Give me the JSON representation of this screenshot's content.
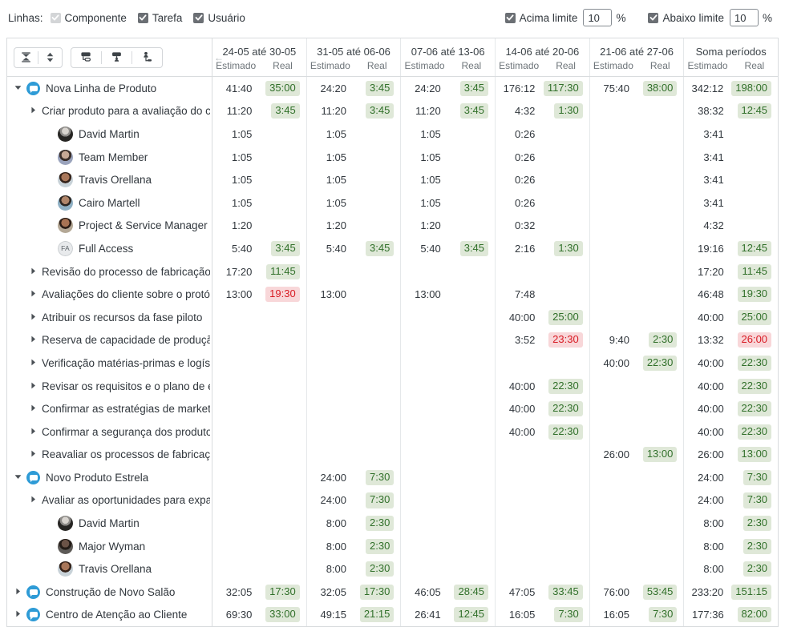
{
  "filters": {
    "rows_label": "Linhas:",
    "checkboxes": [
      {
        "label": "Componente",
        "checked": true,
        "disabled": true
      },
      {
        "label": "Tarefa",
        "checked": true,
        "disabled": false
      },
      {
        "label": "Usuário",
        "checked": true,
        "disabled": false
      }
    ],
    "above_limit": {
      "label": "Acima limite",
      "value": "10",
      "unit": "%",
      "checked": true
    },
    "below_limit": {
      "label": "Abaixo limite",
      "value": "10",
      "unit": "%",
      "checked": true
    }
  },
  "toolbar": {
    "collapse_all": "collapse-all-icon",
    "expand_all": "expand-all-icon",
    "group_component": "group-by-component-icon",
    "group_task": "group-by-task-icon",
    "group_user": "group-by-user-icon",
    "scroll_back": "←"
  },
  "columns": {
    "sub_estimated": "Estimado",
    "sub_real": "Real",
    "periods": [
      "24-05 até 30-05",
      "31-05 até 06-06",
      "07-06 até 13-06",
      "14-06 até 20-06",
      "21-06 até 27-06",
      "Soma períodos"
    ]
  },
  "rows": [
    {
      "name": "Nova Linha de Produto",
      "level": 0,
      "type": "project",
      "expanded": true,
      "cells": [
        {
          "est": "41:40",
          "real": "35:00",
          "state": "ok"
        },
        {
          "est": "24:20",
          "real": "3:45",
          "state": "ok"
        },
        {
          "est": "24:20",
          "real": "3:45",
          "state": "ok"
        },
        {
          "est": "176:12",
          "real": "117:30",
          "state": "ok"
        },
        {
          "est": "75:40",
          "real": "38:00",
          "state": "ok"
        },
        {
          "est": "342:12",
          "real": "198:00",
          "state": "ok"
        }
      ]
    },
    {
      "name": "Criar produto para a avaliação do cliente",
      "level": 1,
      "type": "task",
      "expanded": false,
      "cells": [
        {
          "est": "11:20",
          "real": "3:45",
          "state": "ok"
        },
        {
          "est": "11:20",
          "real": "3:45",
          "state": "ok"
        },
        {
          "est": "11:20",
          "real": "3:45",
          "state": "ok"
        },
        {
          "est": "4:32",
          "real": "1:30",
          "state": "ok"
        },
        {
          "est": "",
          "real": "",
          "state": "none"
        },
        {
          "est": "38:32",
          "real": "12:45",
          "state": "ok"
        }
      ]
    },
    {
      "name": "David Martin",
      "level": 2,
      "type": "user",
      "avatar": "photo-male-1",
      "cells": [
        {
          "est": "1:05",
          "real": "",
          "state": "none"
        },
        {
          "est": "1:05",
          "real": "",
          "state": "none"
        },
        {
          "est": "1:05",
          "real": "",
          "state": "none"
        },
        {
          "est": "0:26",
          "real": "",
          "state": "none"
        },
        {
          "est": "",
          "real": "",
          "state": "none"
        },
        {
          "est": "3:41",
          "real": "",
          "state": "none"
        }
      ]
    },
    {
      "name": "Team Member",
      "level": 2,
      "type": "user",
      "avatar": "photo-male-2",
      "cells": [
        {
          "est": "1:05",
          "real": "",
          "state": "none"
        },
        {
          "est": "1:05",
          "real": "",
          "state": "none"
        },
        {
          "est": "1:05",
          "real": "",
          "state": "none"
        },
        {
          "est": "0:26",
          "real": "",
          "state": "none"
        },
        {
          "est": "",
          "real": "",
          "state": "none"
        },
        {
          "est": "3:41",
          "real": "",
          "state": "none"
        }
      ]
    },
    {
      "name": "Travis Orellana",
      "level": 2,
      "type": "user",
      "avatar": "photo-male-3",
      "cells": [
        {
          "est": "1:05",
          "real": "",
          "state": "none"
        },
        {
          "est": "1:05",
          "real": "",
          "state": "none"
        },
        {
          "est": "1:05",
          "real": "",
          "state": "none"
        },
        {
          "est": "0:26",
          "real": "",
          "state": "none"
        },
        {
          "est": "",
          "real": "",
          "state": "none"
        },
        {
          "est": "3:41",
          "real": "",
          "state": "none"
        }
      ]
    },
    {
      "name": "Cairo Martell",
      "level": 2,
      "type": "user",
      "avatar": "photo-male-4",
      "cells": [
        {
          "est": "1:05",
          "real": "",
          "state": "none"
        },
        {
          "est": "1:05",
          "real": "",
          "state": "none"
        },
        {
          "est": "1:05",
          "real": "",
          "state": "none"
        },
        {
          "est": "0:26",
          "real": "",
          "state": "none"
        },
        {
          "est": "",
          "real": "",
          "state": "none"
        },
        {
          "est": "3:41",
          "real": "",
          "state": "none"
        }
      ]
    },
    {
      "name": "Project & Service Manager",
      "level": 2,
      "type": "user",
      "avatar": "photo-male-5",
      "cells": [
        {
          "est": "1:20",
          "real": "",
          "state": "none"
        },
        {
          "est": "1:20",
          "real": "",
          "state": "none"
        },
        {
          "est": "1:20",
          "real": "",
          "state": "none"
        },
        {
          "est": "0:32",
          "real": "",
          "state": "none"
        },
        {
          "est": "",
          "real": "",
          "state": "none"
        },
        {
          "est": "4:32",
          "real": "",
          "state": "none"
        }
      ]
    },
    {
      "name": "Full Access",
      "level": 2,
      "type": "user",
      "avatar": "initials",
      "initials": "FA",
      "cells": [
        {
          "est": "5:40",
          "real": "3:45",
          "state": "ok"
        },
        {
          "est": "5:40",
          "real": "3:45",
          "state": "ok"
        },
        {
          "est": "5:40",
          "real": "3:45",
          "state": "ok"
        },
        {
          "est": "2:16",
          "real": "1:30",
          "state": "ok"
        },
        {
          "est": "",
          "real": "",
          "state": "none"
        },
        {
          "est": "19:16",
          "real": "12:45",
          "state": "ok"
        }
      ]
    },
    {
      "name": "Revisão do processo de fabricação",
      "level": 1,
      "type": "task",
      "expanded": false,
      "cells": [
        {
          "est": "17:20",
          "real": "11:45",
          "state": "ok"
        },
        {
          "est": "",
          "real": "",
          "state": "none"
        },
        {
          "est": "",
          "real": "",
          "state": "none"
        },
        {
          "est": "",
          "real": "",
          "state": "none"
        },
        {
          "est": "",
          "real": "",
          "state": "none"
        },
        {
          "est": "17:20",
          "real": "11:45",
          "state": "ok"
        }
      ]
    },
    {
      "name": "Avaliações do cliente sobre o protótipo",
      "level": 1,
      "type": "task",
      "expanded": false,
      "cells": [
        {
          "est": "13:00",
          "real": "19:30",
          "state": "bad"
        },
        {
          "est": "13:00",
          "real": "",
          "state": "none"
        },
        {
          "est": "13:00",
          "real": "",
          "state": "none"
        },
        {
          "est": "7:48",
          "real": "",
          "state": "none"
        },
        {
          "est": "",
          "real": "",
          "state": "none"
        },
        {
          "est": "46:48",
          "real": "19:30",
          "state": "ok"
        }
      ]
    },
    {
      "name": "Atribuir os recursos da fase piloto",
      "level": 1,
      "type": "task",
      "expanded": false,
      "cells": [
        {
          "est": "",
          "real": "",
          "state": "none"
        },
        {
          "est": "",
          "real": "",
          "state": "none"
        },
        {
          "est": "",
          "real": "",
          "state": "none"
        },
        {
          "est": "40:00",
          "real": "25:00",
          "state": "ok"
        },
        {
          "est": "",
          "real": "",
          "state": "none"
        },
        {
          "est": "40:00",
          "real": "25:00",
          "state": "ok"
        }
      ]
    },
    {
      "name": "Reserva de capacidade de produção",
      "level": 1,
      "type": "task",
      "expanded": false,
      "cells": [
        {
          "est": "",
          "real": "",
          "state": "none"
        },
        {
          "est": "",
          "real": "",
          "state": "none"
        },
        {
          "est": "",
          "real": "",
          "state": "none"
        },
        {
          "est": "3:52",
          "real": "23:30",
          "state": "bad"
        },
        {
          "est": "9:40",
          "real": "2:30",
          "state": "ok"
        },
        {
          "est": "13:32",
          "real": "26:00",
          "state": "bad"
        }
      ]
    },
    {
      "name": "Verificação matérias-primas e logística",
      "level": 1,
      "type": "task",
      "expanded": false,
      "cells": [
        {
          "est": "",
          "real": "",
          "state": "none"
        },
        {
          "est": "",
          "real": "",
          "state": "none"
        },
        {
          "est": "",
          "real": "",
          "state": "none"
        },
        {
          "est": "",
          "real": "",
          "state": "none"
        },
        {
          "est": "40:00",
          "real": "22:30",
          "state": "ok"
        },
        {
          "est": "40:00",
          "real": "22:30",
          "state": "ok"
        }
      ]
    },
    {
      "name": "Revisar os requisitos e o plano de ensaio",
      "level": 1,
      "type": "task",
      "expanded": false,
      "cells": [
        {
          "est": "",
          "real": "",
          "state": "none"
        },
        {
          "est": "",
          "real": "",
          "state": "none"
        },
        {
          "est": "",
          "real": "",
          "state": "none"
        },
        {
          "est": "40:00",
          "real": "22:30",
          "state": "ok"
        },
        {
          "est": "",
          "real": "",
          "state": "none"
        },
        {
          "est": "40:00",
          "real": "22:30",
          "state": "ok"
        }
      ]
    },
    {
      "name": "Confirmar as estratégias de marketing e",
      "level": 1,
      "type": "task",
      "expanded": false,
      "cells": [
        {
          "est": "",
          "real": "",
          "state": "none"
        },
        {
          "est": "",
          "real": "",
          "state": "none"
        },
        {
          "est": "",
          "real": "",
          "state": "none"
        },
        {
          "est": "40:00",
          "real": "22:30",
          "state": "ok"
        },
        {
          "est": "",
          "real": "",
          "state": "none"
        },
        {
          "est": "40:00",
          "real": "22:30",
          "state": "ok"
        }
      ]
    },
    {
      "name": "Confirmar a segurança dos produtos",
      "level": 1,
      "type": "task",
      "expanded": false,
      "cells": [
        {
          "est": "",
          "real": "",
          "state": "none"
        },
        {
          "est": "",
          "real": "",
          "state": "none"
        },
        {
          "est": "",
          "real": "",
          "state": "none"
        },
        {
          "est": "40:00",
          "real": "22:30",
          "state": "ok"
        },
        {
          "est": "",
          "real": "",
          "state": "none"
        },
        {
          "est": "40:00",
          "real": "22:30",
          "state": "ok"
        }
      ]
    },
    {
      "name": "Reavaliar os processos de fabricação",
      "level": 1,
      "type": "task",
      "expanded": false,
      "cells": [
        {
          "est": "",
          "real": "",
          "state": "none"
        },
        {
          "est": "",
          "real": "",
          "state": "none"
        },
        {
          "est": "",
          "real": "",
          "state": "none"
        },
        {
          "est": "",
          "real": "",
          "state": "none"
        },
        {
          "est": "26:00",
          "real": "13:00",
          "state": "ok"
        },
        {
          "est": "26:00",
          "real": "13:00",
          "state": "ok"
        }
      ]
    },
    {
      "name": "Novo Produto Estrela",
      "level": 0,
      "type": "project",
      "expanded": true,
      "cells": [
        {
          "est": "",
          "real": "",
          "state": "none"
        },
        {
          "est": "24:00",
          "real": "7:30",
          "state": "ok"
        },
        {
          "est": "",
          "real": "",
          "state": "none"
        },
        {
          "est": "",
          "real": "",
          "state": "none"
        },
        {
          "est": "",
          "real": "",
          "state": "none"
        },
        {
          "est": "24:00",
          "real": "7:30",
          "state": "ok"
        }
      ]
    },
    {
      "name": "Avaliar as oportunidades para expandir",
      "level": 1,
      "type": "task",
      "expanded": false,
      "cells": [
        {
          "est": "",
          "real": "",
          "state": "none"
        },
        {
          "est": "24:00",
          "real": "7:30",
          "state": "ok"
        },
        {
          "est": "",
          "real": "",
          "state": "none"
        },
        {
          "est": "",
          "real": "",
          "state": "none"
        },
        {
          "est": "",
          "real": "",
          "state": "none"
        },
        {
          "est": "24:00",
          "real": "7:30",
          "state": "ok"
        }
      ]
    },
    {
      "name": "David Martin",
      "level": 2,
      "type": "user",
      "avatar": "photo-male-1",
      "cells": [
        {
          "est": "",
          "real": "",
          "state": "none"
        },
        {
          "est": "8:00",
          "real": "2:30",
          "state": "ok"
        },
        {
          "est": "",
          "real": "",
          "state": "none"
        },
        {
          "est": "",
          "real": "",
          "state": "none"
        },
        {
          "est": "",
          "real": "",
          "state": "none"
        },
        {
          "est": "8:00",
          "real": "2:30",
          "state": "ok"
        }
      ]
    },
    {
      "name": "Major Wyman",
      "level": 2,
      "type": "user",
      "avatar": "photo-male-6",
      "cells": [
        {
          "est": "",
          "real": "",
          "state": "none"
        },
        {
          "est": "8:00",
          "real": "2:30",
          "state": "ok"
        },
        {
          "est": "",
          "real": "",
          "state": "none"
        },
        {
          "est": "",
          "real": "",
          "state": "none"
        },
        {
          "est": "",
          "real": "",
          "state": "none"
        },
        {
          "est": "8:00",
          "real": "2:30",
          "state": "ok"
        }
      ]
    },
    {
      "name": "Travis Orellana",
      "level": 2,
      "type": "user",
      "avatar": "photo-male-3",
      "cells": [
        {
          "est": "",
          "real": "",
          "state": "none"
        },
        {
          "est": "8:00",
          "real": "2:30",
          "state": "ok"
        },
        {
          "est": "",
          "real": "",
          "state": "none"
        },
        {
          "est": "",
          "real": "",
          "state": "none"
        },
        {
          "est": "",
          "real": "",
          "state": "none"
        },
        {
          "est": "8:00",
          "real": "2:30",
          "state": "ok"
        }
      ]
    },
    {
      "name": "Construção de Novo Salão",
      "level": 0,
      "type": "project",
      "expanded": false,
      "cells": [
        {
          "est": "32:05",
          "real": "17:30",
          "state": "ok"
        },
        {
          "est": "32:05",
          "real": "17:30",
          "state": "ok"
        },
        {
          "est": "46:05",
          "real": "28:45",
          "state": "ok"
        },
        {
          "est": "47:05",
          "real": "33:45",
          "state": "ok"
        },
        {
          "est": "76:00",
          "real": "53:45",
          "state": "ok"
        },
        {
          "est": "233:20",
          "real": "151:15",
          "state": "ok"
        }
      ]
    },
    {
      "name": "Centro de Atenção ao Cliente",
      "level": 0,
      "type": "project",
      "expanded": false,
      "cells": [
        {
          "est": "69:30",
          "real": "33:00",
          "state": "ok"
        },
        {
          "est": "49:15",
          "real": "21:15",
          "state": "ok"
        },
        {
          "est": "26:41",
          "real": "12:45",
          "state": "ok"
        },
        {
          "est": "16:05",
          "real": "7:30",
          "state": "ok"
        },
        {
          "est": "16:05",
          "real": "7:30",
          "state": "ok"
        },
        {
          "est": "177:36",
          "real": "82:00",
          "state": "ok"
        }
      ]
    }
  ]
}
